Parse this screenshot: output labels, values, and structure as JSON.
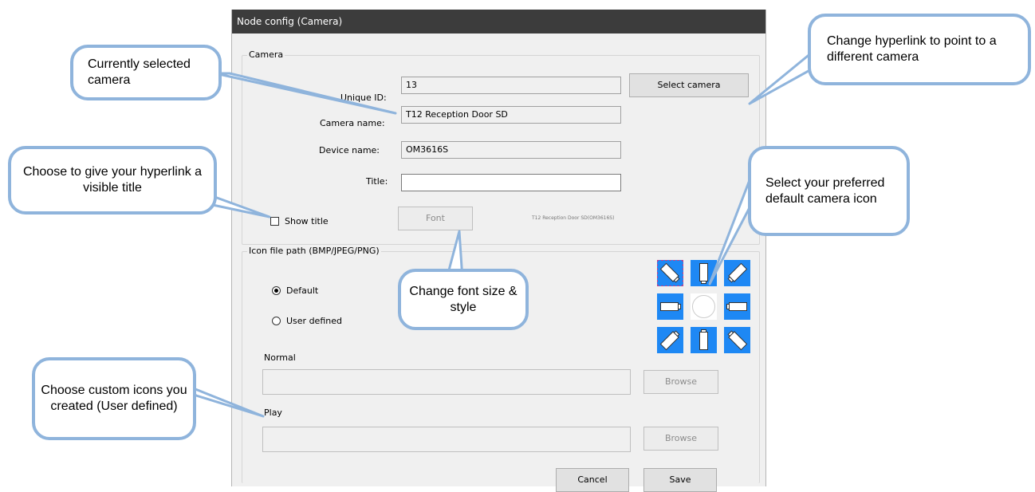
{
  "dialog": {
    "title": "Node config (Camera)",
    "camera_group_label": "Camera",
    "unique_id_label": "Unique ID:",
    "unique_id_value": "13",
    "select_camera_label": "Select camera",
    "camera_name_label": "Camera name:",
    "camera_name_value": "T12 Reception Door SD",
    "device_name_label": "Device name:",
    "device_name_value": "OM3616S",
    "title_label": "Title:",
    "title_value": "",
    "show_title_label": "Show title",
    "show_title_checked": false,
    "font_label": "Font",
    "font_preview": "T12 Reception Door SD(OM3616S)",
    "icon_group_label": "Icon file path (BMP/JPEG/PNG)",
    "radio_default_label": "Default",
    "radio_user_defined_label": "User defined",
    "selected_radio": "Default",
    "normal_label": "Normal",
    "normal_path": "",
    "play_label": "Play",
    "play_path": "",
    "browse_label": "Browse",
    "cancel_label": "Cancel",
    "save_label": "Save",
    "icon_grid": [
      "camera-nw-icon",
      "camera-n-icon",
      "camera-ne-icon",
      "camera-w-icon",
      "camera-center-blank",
      "camera-e-icon",
      "camera-sw-icon",
      "camera-s-icon",
      "camera-se-icon"
    ]
  },
  "callouts": {
    "selected_camera": "Currently selected camera",
    "hyperlink": "Change hyperlink to point to a different camera",
    "visible_title": "Choose to give your hyperlink a visible title",
    "default_icon": "Select your preferred default camera icon",
    "font": "Change font size & style",
    "custom_icons": "Choose custom icons you created (User defined)"
  },
  "colors": {
    "icon_tile": "#1e88f4",
    "callout_border": "#8fb4dc",
    "titlebar": "#3c3c3c"
  }
}
